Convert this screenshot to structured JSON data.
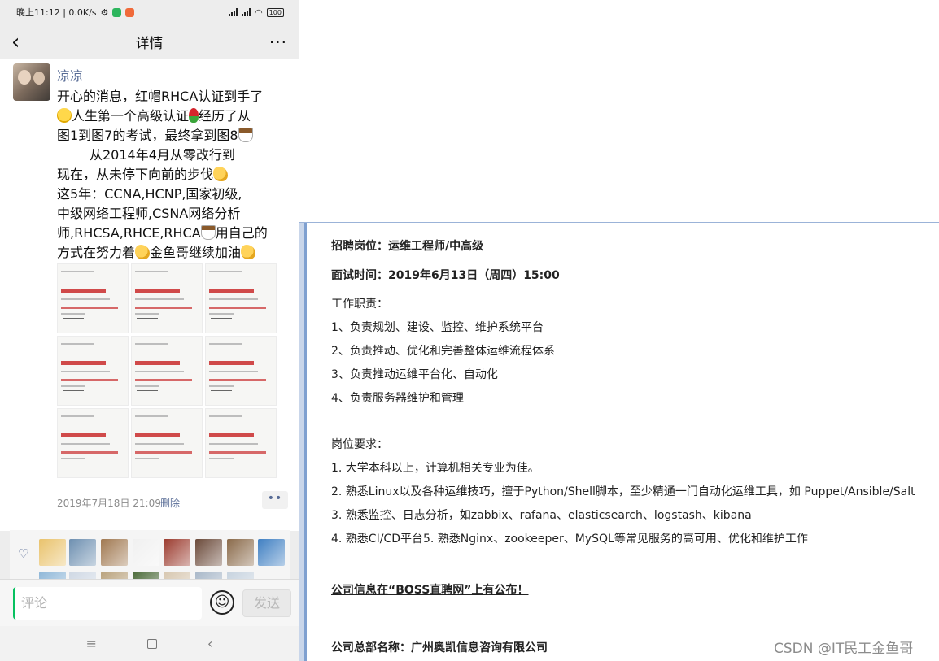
{
  "status_bar": {
    "time_speed": "晚上11:12 | 0.0K/s",
    "battery": "100"
  },
  "nav": {
    "title": "详情",
    "more": "···"
  },
  "post": {
    "username": "凉凉",
    "text_lines": [
      "开心的消息，红帽RHCA认证到手了",
      "人生第一个高级认证",
      "经历了从",
      "图1到图7的考试，最终拿到图8",
      "从2014年4月从零改行到",
      "现在，从未停下向前的步伐",
      "这5年：CCNA,HCNP,国家初级,",
      "中级网络工程师,CSNA网络分析",
      "师,RHCSA,RHCE,RHCA",
      "用自己的",
      "方式在努力着",
      "金鱼哥继续加油"
    ],
    "cert_images": [
      {
        "name": "G WEIBIN",
        "sub": "CERTIFIED SYSTEM ADMINISTRATOR"
      },
      {
        "name": "G WEIBIN",
        "sub": "HAT CERTIFIED ENGINEER"
      },
      {
        "name": "G WEIBIN",
        "sub": "CERTIFIED SPECIALIST IN ANSIBLE AUTOMATION"
      },
      {
        "name": "G WEIBIN",
        "sub": "CERTIFIED SPECIALIST IN SERVER HARDENING"
      },
      {
        "name": "G WEIBIN",
        "sub": "CERTIFIED SPECIALIST IN HIGH AVAILABILITY"
      },
      {
        "name": "G WEIBIN",
        "sub": "CERTIFIED SPECIALIST IN PLATFORM"
      },
      {
        "name": "G WEIBIN",
        "sub": "CERTIFIED SPECIALIST IN CONTAINERS"
      },
      {
        "name": "G WEIBIN",
        "sub": "CERTIFIED SPECIALIST IN DEPLOYMENT"
      },
      {
        "name": "fied Architect in Infrastructure",
        "sub": "DENG WEIBIN"
      }
    ],
    "timestamp": "2019年7月18日 21:09",
    "delete_label": "删除",
    "more_label": "••"
  },
  "likes": {
    "avatar_colors": [
      "#e9c26b",
      "#6d8fb0",
      "#a07850",
      "#f0f0f0",
      "#9b3b2e",
      "#6b4a3a",
      "#8a6a4a",
      "#3f7fc2",
      "#8fb7d8",
      "#cfd8e4",
      "#b9a27d",
      "#4c6b3a",
      "#d7c7b0",
      "#a9b8c9",
      "#c7d3df"
    ]
  },
  "comment": {
    "placeholder": "评论",
    "emoji": "☺",
    "send_label": "发送"
  },
  "system_nav": {
    "menu": "≡",
    "back": "‹"
  },
  "doc": {
    "position_label": "招聘岗位：",
    "position_value": "运维工程师/中高级",
    "interview_label": "面试时间：",
    "interview_value": "2019年6月13日（周四）15:00",
    "duties_title": "工作职责：",
    "duties": [
      "1、负责规划、建设、监控、维护系统平台",
      "2、负责推动、优化和完善整体运维流程体系",
      "3、负责推动运维平台化、自动化",
      "4、负责服务器维护和管理"
    ],
    "requirements_title": "岗位要求：",
    "requirements": [
      "1. 大学本科以上，计算机相关专业为佳。",
      "2. 熟悉Linux以及各种运维技巧，擅于Python/Shell脚本，至少精通一门自动化运维工具，如 Puppet/Ansible/Salt",
      "3. 熟悉监控、日志分析，如zabbix、rafana、elasticsearch、logstash、kibana",
      "4. 熟悉CI/CD平台5. 熟悉Nginx、zookeeper、MySQL等常见服务的高可用、优化和维护工作"
    ],
    "company_info": "公司信息在“BOSS直聘网”上有公布！",
    "company_name": "公司总部名称：广州奥凯信息咨询有限公司"
  },
  "watermark": "CSDN @IT民工金鱼哥"
}
